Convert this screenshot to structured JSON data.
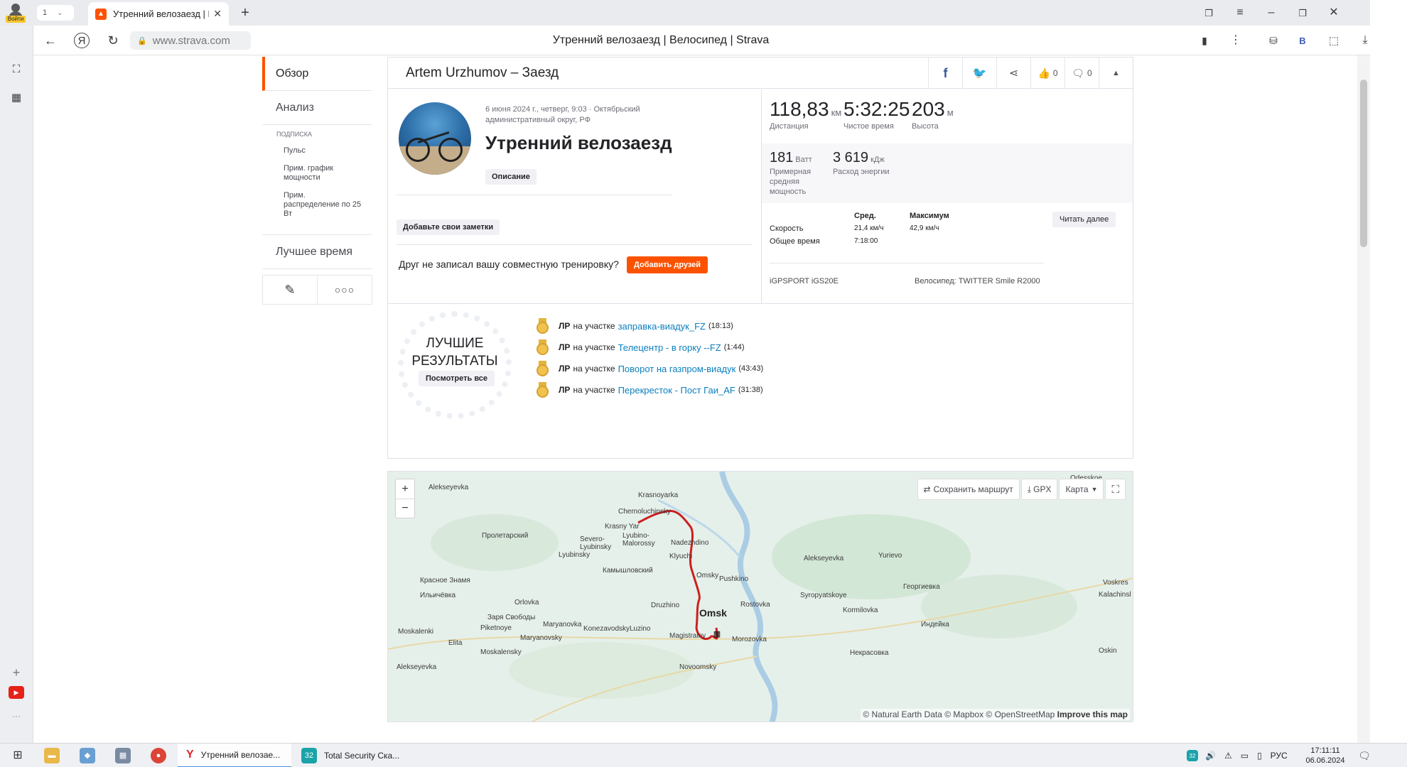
{
  "browser": {
    "login_label": "Войти",
    "tab_count": "1",
    "tab_title": "Утренний велозаезд | Ве",
    "url": "www.strava.com",
    "page_title": "Утренний велозаезд | Велосипед | Strava"
  },
  "sidenav": {
    "overview": "Обзор",
    "analysis": "Анализ",
    "subscription_caption": "ПОДПИСКА",
    "sub_items": [
      "Пульс",
      "Прим. график мощности",
      "Прим. распределение по 25 Вт"
    ],
    "best_time": "Лучшее время",
    "edit_icon": "pencil-icon",
    "more_icon": "more-dots-icon"
  },
  "activity": {
    "header": "Artem Urzhumov – Заезд",
    "likes": "0",
    "comments": "0",
    "date_location": "6 июня 2024 г., четверг, 9:03 · Октябрьский административный округ, РФ",
    "title": "Утренний велозаезд",
    "description_btn": "Описание",
    "add_notes_btn": "Добавьте свои заметки",
    "friend_prompt": "Друг не записал вашу совместную тренировку?",
    "add_friends_btn": "Добавить друзей"
  },
  "stats": {
    "distance": {
      "value": "118,83",
      "unit": "км",
      "label": "Дистанция"
    },
    "moving_time": {
      "value": "5:32:25",
      "label": "Чистое время"
    },
    "elevation": {
      "value": "203",
      "unit": "м",
      "label": "Высота"
    },
    "power": {
      "value": "181",
      "unit": "Ватт",
      "label": "Примерная средняя мощность"
    },
    "energy": {
      "value": "3 619",
      "unit": "кДж",
      "label": "Расход энергии"
    },
    "table": {
      "col_avg": "Сред.",
      "col_max": "Максимум",
      "read_more_btn": "Читать далее",
      "speed_label": "Скорость",
      "speed_avg": "21,4 км/ч",
      "speed_max": "42,9 км/ч",
      "elapsed_label": "Общее время",
      "elapsed_avg": "7:18:00"
    },
    "device": "iGPSPORT iGS20E",
    "bike": "Велосипед: TWITTER Smile R2000"
  },
  "achievements": {
    "title_line1": "ЛУЧШИЕ",
    "title_line2": "РЕЗУЛЬТАТЫ",
    "view_all_btn": "Посмотреть все",
    "items": [
      {
        "badge": "ЛР",
        "prefix": "на участке",
        "segment": "заправка-виадук_FZ",
        "time": "(18:13)"
      },
      {
        "badge": "ЛР",
        "prefix": "на участке",
        "segment": "Телецентр - в горку --FZ",
        "time": "(1:44)"
      },
      {
        "badge": "ЛР",
        "prefix": "на участке",
        "segment": "Поворот на газпром-виадук",
        "time": "(43:43)"
      },
      {
        "badge": "ЛР",
        "prefix": "на участке",
        "segment": "Перекресток - Пост Гаи_AF",
        "time": "(31:38)"
      }
    ]
  },
  "map": {
    "zoom_in": "+",
    "zoom_out": "−",
    "save_route": "Сохранить маршрут",
    "gpx": "GPX",
    "map_type": "Карта",
    "attribution": "© Natural Earth Data © Mapbox © OpenStreetMap",
    "improve": "Improve this map",
    "places": {
      "alekseyevka_w": "Alekseyevka",
      "krasnoyarka": "Krasnoyarka",
      "odesskoe": "Odesskoe",
      "chernoluchinsky": "Chernoluchinsky",
      "krasny_yar": "Krasny Yar",
      "proletarsky": "Пролетарский",
      "severo_lyubinsky": "Severo-Lyubinsky",
      "lyubino_malorossy": "Lyubino-Malorossy",
      "nadezhdino": "Nadezhdino",
      "lyubinsky": "Lyubinsky",
      "klyuchi": "Klyuchi",
      "alekseyevka_e": "Alekseyevka",
      "yurievo": "Yurievo",
      "kamyshlovsky": "Камышловский",
      "omsky": "Omsky",
      "pushkino": "Pushkino",
      "krasnoe_znamya": "Красное Знамя",
      "vokresenka": "Voskres",
      "ilyichevka": "Ильичёвка",
      "syropyatskoye": "Syropyatskoye",
      "georgievka": "Георгиевка",
      "kalachinsk": "Kalachinsl",
      "orlovka": "Orlovka",
      "druzhino": "Druzhino",
      "omsk": "Omsk",
      "rostovka": "Rostovka",
      "kormilovka": "Kormilovka",
      "zarya_svobody": "Заря Свободы",
      "maryanovka": "Maryanovka",
      "piketnoye": "Piketnoye",
      "konezavodsky": "Konezavodsky",
      "luzino": "Luzino",
      "indeyka": "Индейка",
      "moskalenki": "Moskalenki",
      "maryanovsky": "Maryanovsky",
      "elita": "Elita",
      "magistralny": "Magistralny",
      "morozovka": "Morozovka",
      "moskalensky": "Moskalensky",
      "nekrasovka": "Некрасовка",
      "oskin": "Oskin",
      "alekseyevka_s": "Alekseyevka",
      "novoomsky": "Novoomsky"
    }
  },
  "taskbar": {
    "app1": "Утренний велозае...",
    "app2": "Total Security Ска...",
    "lang": "РУС",
    "time": "17:11:11",
    "date": "06.06.2024"
  }
}
